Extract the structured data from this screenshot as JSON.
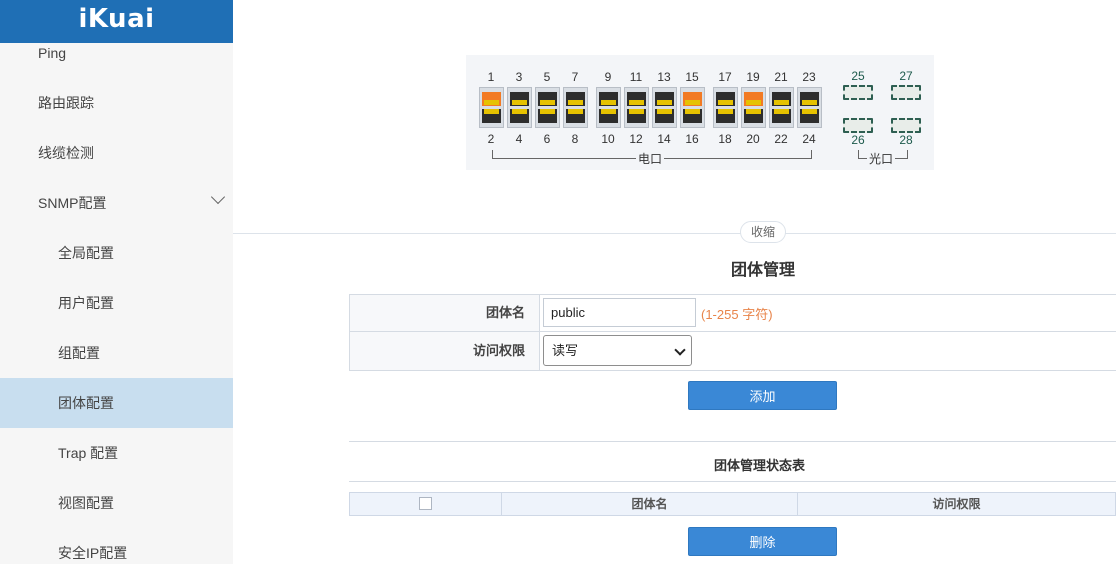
{
  "brand": {
    "logo_text": "iKuai",
    "color": "#1f6fb5"
  },
  "sidebar": {
    "items": [
      {
        "label": "Ping"
      },
      {
        "label": "路由跟踪"
      },
      {
        "label": "线缆检测"
      },
      {
        "label": "SNMP配置",
        "expanded": true,
        "icon": "chevron-down-icon"
      },
      {
        "label": "全局配置"
      },
      {
        "label": "用户配置"
      },
      {
        "label": "组配置"
      },
      {
        "label": "团体配置",
        "active": true
      },
      {
        "label": "Trap 配置"
      },
      {
        "label": "视图配置"
      },
      {
        "label": "安全IP配置"
      }
    ]
  },
  "switch_panel": {
    "top_numbers": [
      "1",
      "3",
      "5",
      "7",
      "9",
      "11",
      "13",
      "15",
      "17",
      "19",
      "21",
      "23"
    ],
    "bottom_numbers": [
      "2",
      "4",
      "6",
      "8",
      "10",
      "12",
      "14",
      "16",
      "18",
      "20",
      "22",
      "24"
    ],
    "active_top_ports": [
      "1",
      "15",
      "19"
    ],
    "sfp_top_numbers": [
      "25",
      "27"
    ],
    "sfp_bottom_numbers": [
      "26",
      "28"
    ],
    "copper_label": "电口",
    "fiber_label": "光口",
    "active_color": "#f27a23"
  },
  "collapse_label": "收缩",
  "community": {
    "title": "团体管理",
    "name_label": "团体名",
    "name_value": "public",
    "name_hint": "(1-255 字符)",
    "access_label": "访问权限",
    "access_selected": "读写",
    "add_button": "添加"
  },
  "status_table": {
    "title": "团体管理状态表",
    "columns": [
      "团体名",
      "访问权限"
    ],
    "rows": [],
    "delete_button": "删除"
  }
}
